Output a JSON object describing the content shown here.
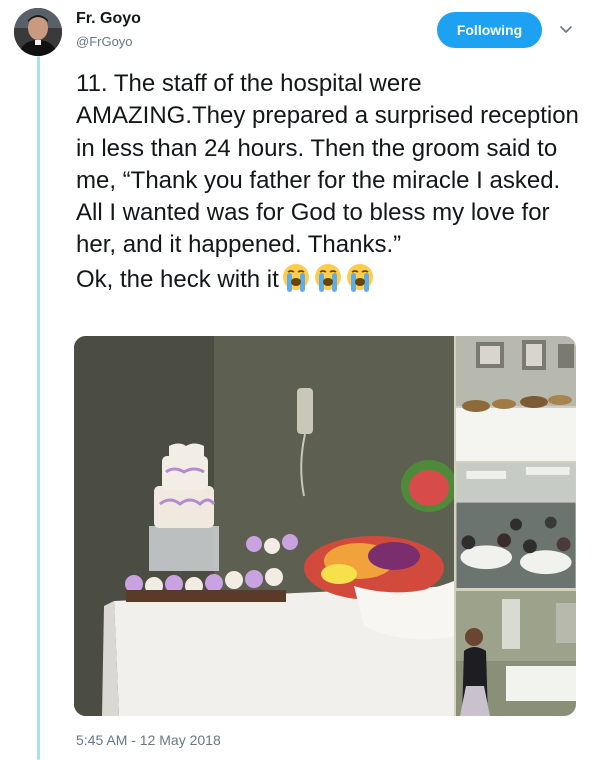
{
  "user": {
    "display_name": "Fr. Goyo",
    "handle": "@FrGoyo"
  },
  "follow_button": {
    "label": "Following"
  },
  "tweet": {
    "text": "11. The staff of the hospital were AMAZING.They prepared a surprised reception in less than 24 hours. Then the groom said to me, “Thank you father for the miracle I asked. All I wanted was for God to bless my love for her, and it happened. Thanks.”\nOk, the heck with it",
    "emoji": [
      "loudly-crying-face",
      "loudly-crying-face",
      "loudly-crying-face"
    ],
    "timestamp": "5:45 AM - 12 May 2018"
  },
  "media": {
    "photos": [
      "wedding-cake-and-cupcakes",
      "buffet-table",
      "reception-dining-room",
      "hospital-room-reception"
    ]
  },
  "colors": {
    "accent": "#1da1f2",
    "thread_line": "#a7dff3",
    "secondary_text": "#657786"
  }
}
